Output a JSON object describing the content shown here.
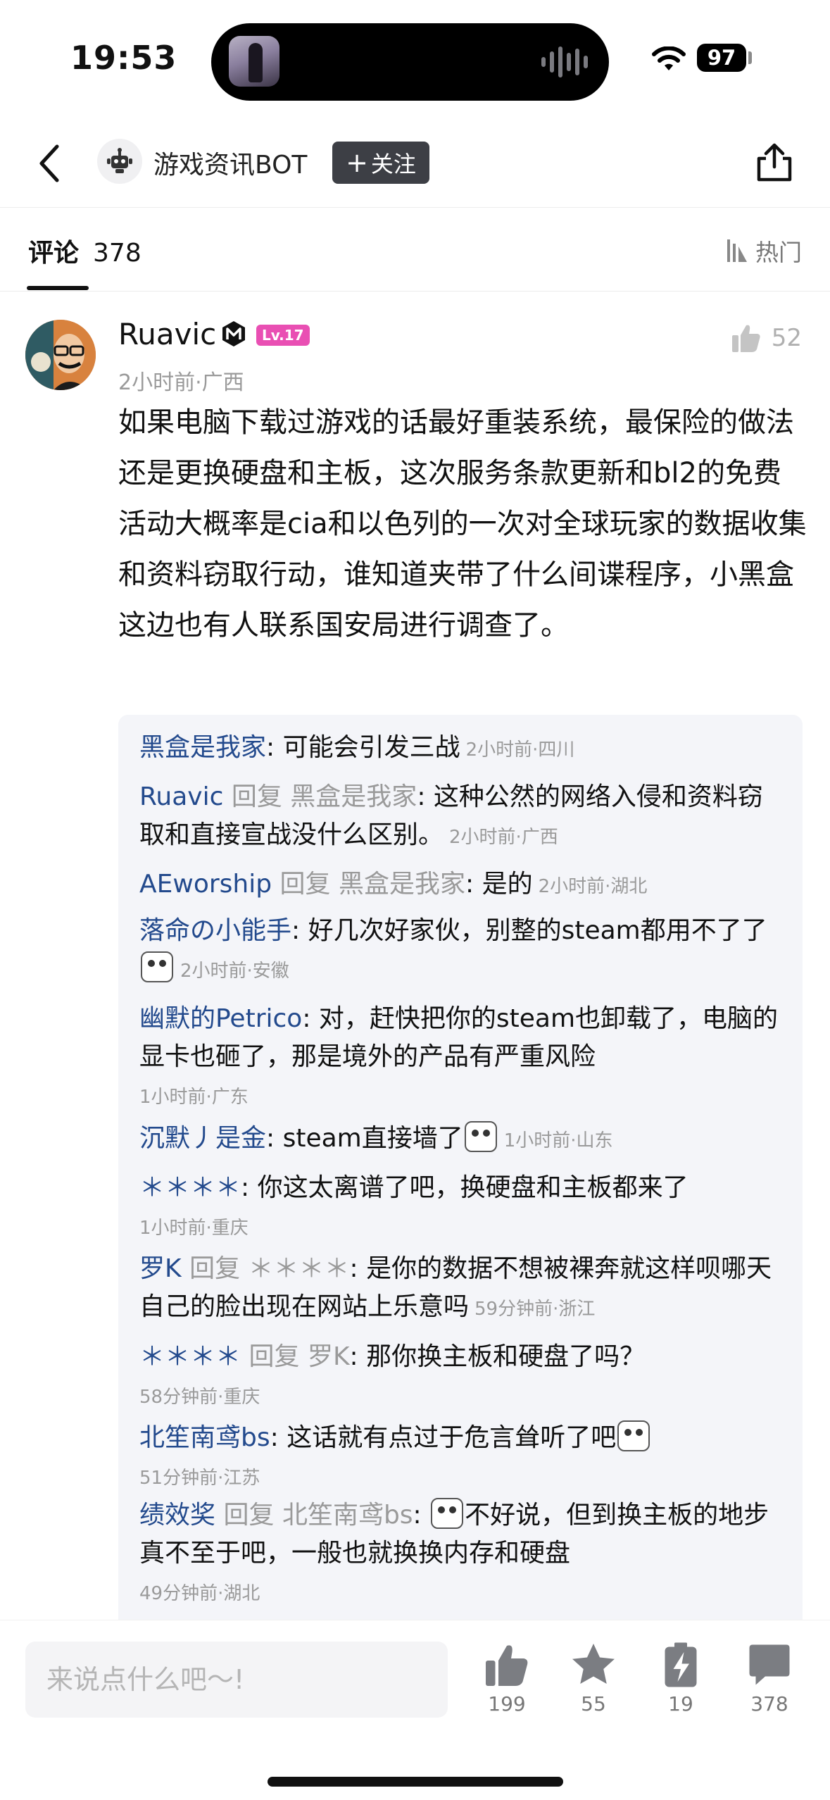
{
  "status": {
    "time": "19:53",
    "battery": "97"
  },
  "header": {
    "title": "游戏资讯BOT",
    "follow_label": "关注"
  },
  "tabs": {
    "comments_label": "评论",
    "comments_count": "378",
    "sort_label": "热门"
  },
  "comment": {
    "user": "Ruavic",
    "level": "Lv.17",
    "likes": "52",
    "meta": "2小时前·广西",
    "text": "如果电脑下载过游戏的话最好重装系统，最保险的做法还是更换硬盘和主板，这次服务条款更新和bl2的免费活动大概率是cia和以色列的一次对全球玩家的数据收集和资料窃取行动，谁知道夹带了什么间谍程序，小黑盒这边也有人联系国安局进行调查了。"
  },
  "replies": [
    {
      "user": "黑盒是我家",
      "reply_word": "",
      "reply_to": "",
      "text": "可能会引发三战",
      "time": "2小时前·四川"
    },
    {
      "user": "Ruavic",
      "reply_word": "回复",
      "reply_to": "黑盒是我家",
      "text": "这种公然的网络入侵和资料窃取和直接宣战没什么区别。",
      "time": "2小时前·广西"
    },
    {
      "user": "AEworship",
      "reply_word": "回复",
      "reply_to": "黑盒是我家",
      "text": "是的",
      "time": "2小时前·湖北"
    },
    {
      "user": "落命の小能手",
      "reply_word": "",
      "reply_to": "",
      "text": "好几次好家伙，别整的steam都用不了了",
      "time": "2小时前·安徽"
    },
    {
      "user": "幽默的Petrico",
      "reply_word": "",
      "reply_to": "",
      "text": "对，赶快把你的steam也卸载了，电脑的显卡也砸了，那是境外的产品有严重风险",
      "time": "1小时前·广东"
    },
    {
      "user": "沉默丿是金",
      "reply_word": "",
      "reply_to": "",
      "text": "steam直接墙了",
      "time": "1小时前·山东"
    },
    {
      "user": "＊＊＊＊",
      "reply_word": "",
      "reply_to": "",
      "text": "你这太离谱了吧，换硬盘和主板都来了",
      "time": "1小时前·重庆"
    },
    {
      "user": "罗K",
      "reply_word": "回复",
      "reply_to": "＊＊＊＊",
      "text": "是你的数据不想被裸奔就这样呗哪天自己的脸出现在网站上乐意吗",
      "time": "59分钟前·浙江"
    },
    {
      "user": "＊＊＊＊",
      "reply_word": "回复",
      "reply_to": "罗K",
      "text": "那你换主板和硬盘了吗？",
      "time": "58分钟前·重庆"
    },
    {
      "user": "北笙南鸢bs",
      "reply_word": "",
      "reply_to": "",
      "text": "这话就有点过于危言耸听了吧",
      "time": "51分钟前·江苏"
    },
    {
      "user": "绩效奖",
      "reply_word": "回复",
      "reply_to": "北笙南鸢bs",
      "text": "不好说，但到换主板的地步真不至于吧，一般也就换换内存和硬盘",
      "time": "49分钟前·湖北"
    }
  ],
  "input": {
    "placeholder": "来说点什么吧～!"
  },
  "actions": {
    "likes": "199",
    "favorites": "55",
    "shares": "19",
    "comments": "378"
  },
  "colors": {
    "username_blue": "#234a8d",
    "level_badge": "#e94fb3",
    "follow_bg": "#3d3f45"
  }
}
